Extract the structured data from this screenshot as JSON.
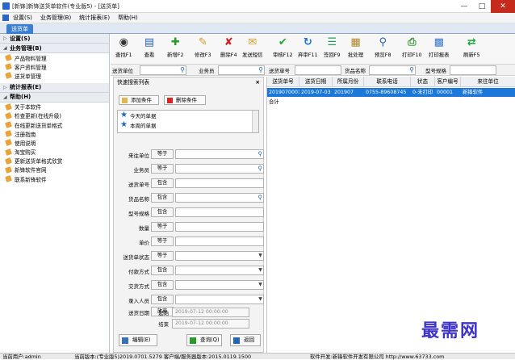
{
  "window": {
    "title": "[新锋]新锋送货单软件(专业版5) - [送货单]"
  },
  "menu": [
    "设置(S)",
    "业务管理(B)",
    "统计报表(E)",
    "帮助(H)"
  ],
  "tab": "送货单",
  "sidebar": {
    "sections": [
      {
        "label": "设置(S)",
        "items": []
      },
      {
        "label": "业务管理(B)",
        "items": [
          "产品物料管理",
          "客户资料管理",
          "送货单管理"
        ]
      },
      {
        "label": "统计报表(E)",
        "items": []
      },
      {
        "label": "帮助(H)",
        "items": [
          "关于本软件",
          "检查更新(在线升级)",
          "在线更新送货单格式",
          "注册指南",
          "使用说明",
          "淘宝购买",
          "更新送货单格式欣赏",
          "新锋软件官网",
          "联系新锋软件"
        ]
      }
    ]
  },
  "toolbar": [
    "查找F1",
    "查看",
    "新增F2",
    "修改F3",
    "删除F4",
    "发送短信",
    "审核F12",
    "弃审F11",
    "签回F9",
    "批处理",
    "预览F8",
    "打印F10",
    "打印报表",
    "刷新F5"
  ],
  "search": {
    "customer": "送货单位",
    "salesman": "业务员",
    "order_no": "送货单号",
    "product": "货品名称",
    "model": "型号规格"
  },
  "query_panel": {
    "title": "快速搜索列表",
    "close": "×",
    "add_btn": "添加条件",
    "del_btn": "删除条件",
    "saved": [
      "今天的单据",
      "本周的单据"
    ],
    "criteria": [
      {
        "label": "来往单位",
        "op": "等于"
      },
      {
        "label": "业务员",
        "op": "等于"
      },
      {
        "label": "送货单号",
        "op": "包含"
      },
      {
        "label": "货品名称",
        "op": "包含"
      },
      {
        "label": "型号规格",
        "op": "包含"
      },
      {
        "label": "数量",
        "op": "等于"
      },
      {
        "label": "单价",
        "op": "等于"
      },
      {
        "label": "送货单状态",
        "op": "等于"
      },
      {
        "label": "付款方式",
        "op": "包含"
      },
      {
        "label": "交货方式",
        "op": "包含"
      },
      {
        "label": "录入人员",
        "op": "包含"
      },
      {
        "label": "送货日期",
        "op": "放弃"
      }
    ],
    "date_from_label": "起始",
    "date_to_label": "结束",
    "date_from": "2019-07-12 00:00:00",
    "date_to": "2019-07-12 00:00:00",
    "edit_btn": "编辑(E)",
    "query_btn": "查询(Q)",
    "back_btn": "返回"
  },
  "grid": {
    "columns": [
      "送货单号",
      "送货日期",
      "所属月份",
      "联系电话",
      "状态",
      "客户编号",
      "来往单位"
    ],
    "rows": [
      [
        "2019070001",
        "2019-07-03",
        "201907",
        "0755-89608745",
        "0-未打印",
        "00001",
        "新锋软件"
      ]
    ],
    "total_label": "合计"
  },
  "status": {
    "user": "当前用户:admin",
    "version": "当前版本:(专业版5)2019.0701.5279 客户端/服务器版本:2015.0119.1500",
    "dev": "软件开发:新锋软件开发有限公司 http://www.63733.com"
  },
  "watermark": "最需网"
}
